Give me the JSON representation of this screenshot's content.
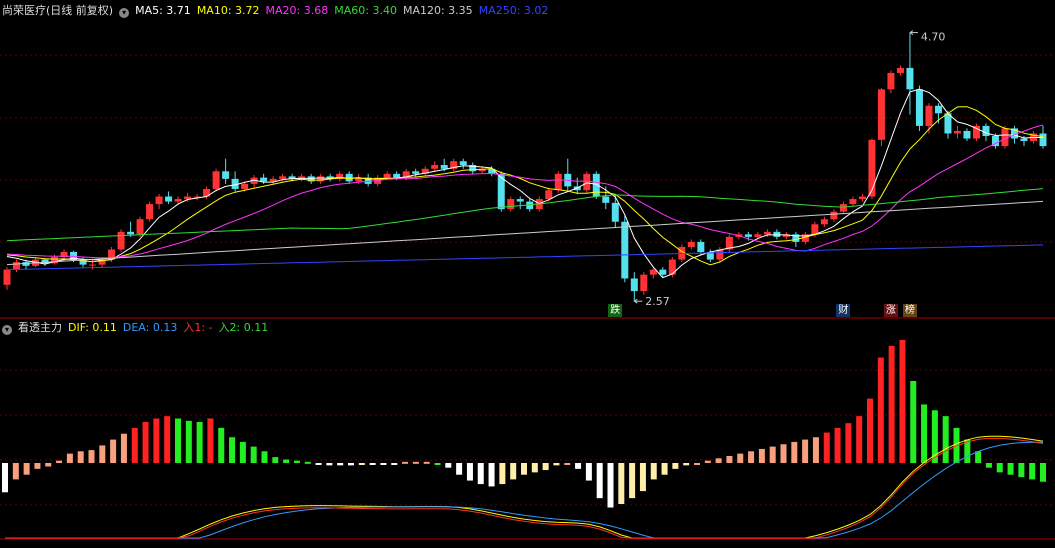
{
  "upper": {
    "title": "尚荣医疗(日线 前复权)",
    "ma": [
      {
        "label": "MA5: 3.71",
        "color": "#ffffff"
      },
      {
        "label": "MA10: 3.72",
        "color": "#ffff00"
      },
      {
        "label": "MA20: 3.68",
        "color": "#ff33ff"
      },
      {
        "label": "MA60: 3.40",
        "color": "#33dd33"
      },
      {
        "label": "MA120: 3.35",
        "color": "#cccccc"
      },
      {
        "label": "MA250: 3.02",
        "color": "#3344ff"
      }
    ],
    "high_label": "4.70",
    "low_label": "2.57",
    "markers": [
      {
        "text": "跌",
        "color": "#ffffff",
        "bg": "#116611"
      },
      {
        "text": "财",
        "color": "#ffffff",
        "bg": "#113366"
      },
      {
        "text": "涨",
        "color": "#ffffff",
        "bg": "#661111"
      },
      {
        "text": "榜",
        "color": "#ffffff",
        "bg": "#664411"
      }
    ]
  },
  "lower": {
    "title": "看透主力",
    "items": [
      {
        "label": "DIF: 0.11",
        "color": "#ffff00"
      },
      {
        "label": "DEA: 0.13",
        "color": "#3399ff"
      },
      {
        "label": "入1: -",
        "color": "#ff3333"
      },
      {
        "label": "入2: 0.11",
        "color": "#33dd33"
      }
    ]
  },
  "colors": {
    "up": "#ff3333",
    "down": "#55e0ee",
    "grid": "#660000",
    "separator": "#aa0000"
  },
  "chart_data": {
    "type": "candlestick",
    "candles": [
      [
        2.7,
        2.82,
        2.66,
        2.84
      ],
      [
        2.82,
        2.88,
        2.8,
        2.9
      ],
      [
        2.88,
        2.85,
        2.82,
        2.9
      ],
      [
        2.85,
        2.9,
        2.84,
        2.92
      ],
      [
        2.9,
        2.87,
        2.85,
        2.91
      ],
      [
        2.87,
        2.92,
        2.86,
        2.94
      ],
      [
        2.92,
        2.96,
        2.9,
        2.98
      ],
      [
        2.96,
        2.9,
        2.88,
        2.97
      ],
      [
        2.9,
        2.86,
        2.84,
        2.92
      ],
      [
        2.86,
        2.86,
        2.82,
        2.9
      ],
      [
        2.86,
        2.9,
        2.84,
        2.92
      ],
      [
        2.9,
        2.98,
        2.88,
        3.0
      ],
      [
        2.98,
        3.12,
        2.96,
        3.14
      ],
      [
        3.12,
        3.1,
        3.08,
        3.2
      ],
      [
        3.1,
        3.22,
        3.08,
        3.24
      ],
      [
        3.22,
        3.34,
        3.2,
        3.36
      ],
      [
        3.34,
        3.4,
        3.3,
        3.42
      ],
      [
        3.4,
        3.36,
        3.34,
        3.44
      ],
      [
        3.36,
        3.38,
        3.34,
        3.4
      ],
      [
        3.38,
        3.4,
        3.36,
        3.43
      ],
      [
        3.4,
        3.4,
        3.37,
        3.42
      ],
      [
        3.4,
        3.46,
        3.38,
        3.48
      ],
      [
        3.46,
        3.6,
        3.44,
        3.62
      ],
      [
        3.6,
        3.54,
        3.5,
        3.7
      ],
      [
        3.54,
        3.46,
        3.44,
        3.6
      ],
      [
        3.46,
        3.5,
        3.44,
        3.52
      ],
      [
        3.5,
        3.55,
        3.47,
        3.57
      ],
      [
        3.55,
        3.52,
        3.5,
        3.58
      ],
      [
        3.52,
        3.54,
        3.5,
        3.56
      ],
      [
        3.54,
        3.56,
        3.52,
        3.58
      ],
      [
        3.56,
        3.54,
        3.52,
        3.58
      ],
      [
        3.54,
        3.56,
        3.52,
        3.58
      ],
      [
        3.56,
        3.52,
        3.5,
        3.58
      ],
      [
        3.52,
        3.56,
        3.5,
        3.58
      ],
      [
        3.56,
        3.54,
        3.52,
        3.58
      ],
      [
        3.54,
        3.58,
        3.52,
        3.6
      ],
      [
        3.58,
        3.52,
        3.5,
        3.6
      ],
      [
        3.52,
        3.55,
        3.5,
        3.58
      ],
      [
        3.55,
        3.5,
        3.48,
        3.58
      ],
      [
        3.5,
        3.55,
        3.48,
        3.57
      ],
      [
        3.55,
        3.58,
        3.53,
        3.6
      ],
      [
        3.58,
        3.55,
        3.53,
        3.6
      ],
      [
        3.55,
        3.6,
        3.53,
        3.62
      ],
      [
        3.6,
        3.58,
        3.55,
        3.62
      ],
      [
        3.58,
        3.62,
        3.56,
        3.64
      ],
      [
        3.62,
        3.65,
        3.6,
        3.68
      ],
      [
        3.65,
        3.62,
        3.6,
        3.7
      ],
      [
        3.62,
        3.68,
        3.6,
        3.7
      ],
      [
        3.68,
        3.65,
        3.62,
        3.7
      ],
      [
        3.65,
        3.6,
        3.58,
        3.67
      ],
      [
        3.6,
        3.62,
        3.58,
        3.64
      ],
      [
        3.62,
        3.58,
        3.56,
        3.64
      ],
      [
        3.58,
        3.3,
        3.28,
        3.6
      ],
      [
        3.3,
        3.38,
        3.28,
        3.4
      ],
      [
        3.38,
        3.36,
        3.3,
        3.4
      ],
      [
        3.36,
        3.3,
        3.28,
        3.38
      ],
      [
        3.3,
        3.38,
        3.28,
        3.4
      ],
      [
        3.38,
        3.45,
        3.36,
        3.47
      ],
      [
        3.45,
        3.58,
        3.43,
        3.6
      ],
      [
        3.58,
        3.48,
        3.44,
        3.7
      ],
      [
        3.48,
        3.45,
        3.42,
        3.55
      ],
      [
        3.45,
        3.58,
        3.43,
        3.6
      ],
      [
        3.58,
        3.4,
        3.38,
        3.6
      ],
      [
        3.4,
        3.35,
        3.3,
        3.48
      ],
      [
        3.35,
        3.2,
        3.15,
        3.42
      ],
      [
        3.2,
        2.75,
        2.72,
        3.25
      ],
      [
        2.75,
        2.65,
        2.57,
        2.8
      ],
      [
        2.65,
        2.78,
        2.62,
        2.8
      ],
      [
        2.78,
        2.82,
        2.75,
        2.84
      ],
      [
        2.82,
        2.78,
        2.76,
        2.84
      ],
      [
        2.78,
        2.9,
        2.76,
        2.92
      ],
      [
        2.9,
        3.0,
        2.88,
        3.02
      ],
      [
        3.0,
        3.04,
        2.98,
        3.06
      ],
      [
        3.04,
        2.96,
        2.94,
        3.06
      ],
      [
        2.96,
        2.9,
        2.88,
        2.98
      ],
      [
        2.9,
        2.98,
        2.88,
        3.0
      ],
      [
        2.98,
        3.08,
        2.96,
        3.1
      ],
      [
        3.08,
        3.1,
        3.06,
        3.12
      ],
      [
        3.1,
        3.08,
        3.05,
        3.12
      ],
      [
        3.08,
        3.1,
        3.06,
        3.12
      ],
      [
        3.1,
        3.12,
        3.08,
        3.14
      ],
      [
        3.12,
        3.08,
        3.06,
        3.14
      ],
      [
        3.08,
        3.1,
        3.06,
        3.12
      ],
      [
        3.1,
        3.04,
        3.0,
        3.12
      ],
      [
        3.04,
        3.1,
        3.02,
        3.12
      ],
      [
        3.1,
        3.18,
        3.08,
        3.2
      ],
      [
        3.18,
        3.22,
        3.16,
        3.24
      ],
      [
        3.22,
        3.28,
        3.2,
        3.3
      ],
      [
        3.28,
        3.34,
        3.26,
        3.36
      ],
      [
        3.34,
        3.38,
        3.32,
        3.4
      ],
      [
        3.38,
        3.4,
        3.36,
        3.42
      ],
      [
        3.4,
        3.85,
        3.38,
        3.86
      ],
      [
        3.85,
        4.25,
        3.8,
        4.26
      ],
      [
        4.25,
        4.38,
        4.22,
        4.4
      ],
      [
        4.38,
        4.42,
        4.36,
        4.44
      ],
      [
        4.42,
        4.25,
        4.05,
        4.7
      ],
      [
        4.25,
        3.96,
        3.92,
        4.28
      ],
      [
        3.96,
        4.12,
        3.9,
        4.14
      ],
      [
        4.12,
        4.06,
        3.98,
        4.14
      ],
      [
        4.06,
        3.9,
        3.86,
        4.08
      ],
      [
        3.9,
        3.92,
        3.86,
        3.96
      ],
      [
        3.92,
        3.86,
        3.84,
        3.94
      ],
      [
        3.86,
        3.96,
        3.84,
        3.98
      ],
      [
        3.96,
        3.88,
        3.84,
        3.98
      ],
      [
        3.88,
        3.8,
        3.78,
        3.9
      ],
      [
        3.8,
        3.94,
        3.78,
        3.96
      ],
      [
        3.94,
        3.86,
        3.82,
        3.96
      ],
      [
        3.86,
        3.84,
        3.8,
        3.88
      ],
      [
        3.84,
        3.9,
        3.82,
        3.92
      ],
      [
        3.9,
        3.8,
        3.78,
        3.96
      ]
    ],
    "osc_bars": [
      -0.25,
      -0.14,
      -0.1,
      -0.05,
      -0.03,
      0.02,
      0.08,
      0.1,
      0.11,
      0.15,
      0.2,
      0.25,
      0.3,
      0.35,
      0.38,
      0.4,
      0.38,
      0.36,
      0.35,
      0.38,
      0.3,
      0.22,
      0.18,
      0.14,
      0.1,
      0.05,
      0.03,
      0.02,
      0.01,
      -0.01,
      -0.02,
      -0.02,
      -0.02,
      -0.01,
      -0.01,
      -0.01,
      -0.01,
      0.01,
      0.01,
      0.01,
      0.0,
      -0.04,
      -0.1,
      -0.15,
      -0.18,
      -0.2,
      -0.18,
      -0.14,
      -0.1,
      -0.08,
      -0.06,
      -0.02,
      0.0,
      -0.05,
      -0.15,
      -0.3,
      -0.38,
      -0.35,
      -0.3,
      -0.24,
      -0.14,
      -0.1,
      -0.05,
      -0.02,
      0.0,
      0.02,
      0.04,
      0.06,
      0.08,
      0.1,
      0.12,
      0.14,
      0.16,
      0.18,
      0.2,
      0.22,
      0.26,
      0.3,
      0.34,
      0.4,
      0.55,
      0.9,
      1.0,
      1.05,
      0.7,
      0.5,
      0.45,
      0.4,
      0.3,
      0.2,
      0.1,
      -0.04,
      -0.08,
      -0.1,
      -0.12,
      -0.14,
      -0.16
    ],
    "ylim": [
      2.5,
      4.8
    ]
  }
}
